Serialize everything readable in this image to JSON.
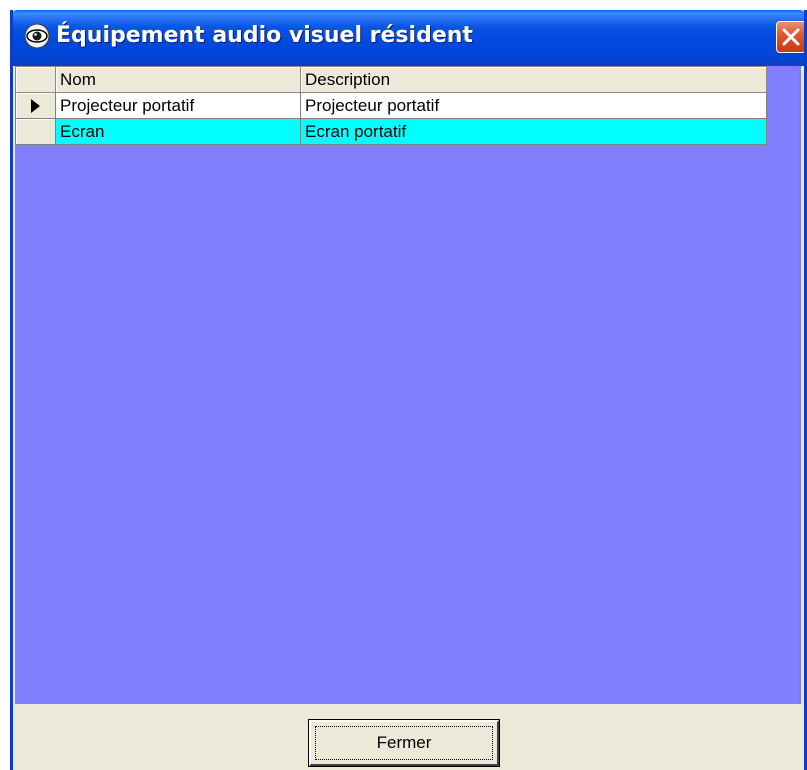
{
  "window": {
    "title": "Équipement audio visuel résident",
    "title_icon": "eye-icon",
    "close_icon": "close-icon"
  },
  "grid": {
    "columns": [
      "Nom",
      "Description"
    ],
    "rows": [
      {
        "nom": "Projecteur portatif",
        "description": "Projecteur portatif",
        "current": true,
        "selected": false
      },
      {
        "nom": "Ecran",
        "description": "Ecran portatif",
        "current": false,
        "selected": true
      }
    ],
    "row_pointer_icon": "row-pointer-icon",
    "colors": {
      "background": "#8080ff",
      "selected_row": "#00ffff",
      "normal_row": "#ffffff"
    }
  },
  "footer": {
    "close_button_label": "Fermer"
  }
}
